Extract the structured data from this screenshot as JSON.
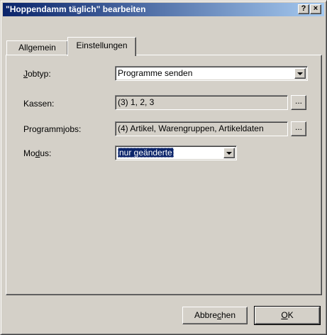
{
  "window": {
    "title": "\"Hoppendamm täglich\" bearbeiten",
    "help_button": "?",
    "close_button": "×"
  },
  "tabs": [
    {
      "label": "Allgemein",
      "active": false
    },
    {
      "label": "Einstellungen",
      "active": true
    }
  ],
  "form": {
    "jobtyp": {
      "label_pre": "",
      "label_mnemonic": "J",
      "label_post": "obtyp:",
      "value": "Programme senden"
    },
    "kassen": {
      "label": "Kassen:",
      "value": "(3) 1, 2, 3",
      "browse_label": "..."
    },
    "programmjobs": {
      "label": "Programmjobs:",
      "value": "(4) Artikel, Warengruppen, Artikeldaten",
      "browse_label": "..."
    },
    "modus": {
      "label_pre": "Mo",
      "label_mnemonic": "d",
      "label_post": "us:",
      "value": "nur geänderte"
    }
  },
  "buttons": {
    "cancel": {
      "pre": "Abbre",
      "mnemonic": "c",
      "post": "hen"
    },
    "ok": {
      "pre": "",
      "mnemonic": "O",
      "post": "K"
    }
  },
  "colors": {
    "titlebar_start": "#0a246a",
    "titlebar_end": "#a6caf0",
    "dialog_bg": "#d4d0c8",
    "selection": "#0a246a"
  }
}
